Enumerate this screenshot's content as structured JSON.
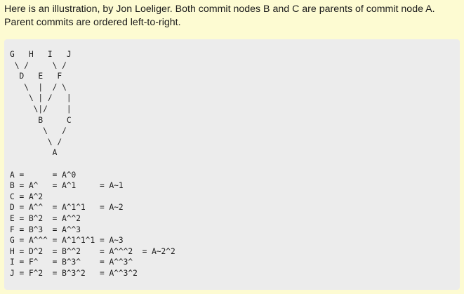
{
  "intro": {
    "line1": "Here is an illustration, by Jon Loeliger. Both commit nodes B and C are parents of commit node A.",
    "line2": "Parent commits are ordered left-to-right."
  },
  "code_lines": [
    "G   H   I   J",
    " \\ /     \\ /",
    "  D   E   F",
    "   \\  |  / \\",
    "    \\ | /   |",
    "     \\|/    |",
    "      B     C",
    "       \\   /",
    "        \\ /",
    "         A",
    "",
    "A =      = A^0",
    "B = A^   = A^1     = A~1",
    "C = A^2",
    "D = A^^  = A^1^1   = A~2",
    "E = B^2  = A^^2",
    "F = B^3  = A^^3",
    "G = A^^^ = A^1^1^1 = A~3",
    "H = D^2  = B^^2    = A^^^2  = A~2^2",
    "I = F^   = B^3^    = A^^3^",
    "J = F^2  = B^3^2   = A^^3^2"
  ]
}
